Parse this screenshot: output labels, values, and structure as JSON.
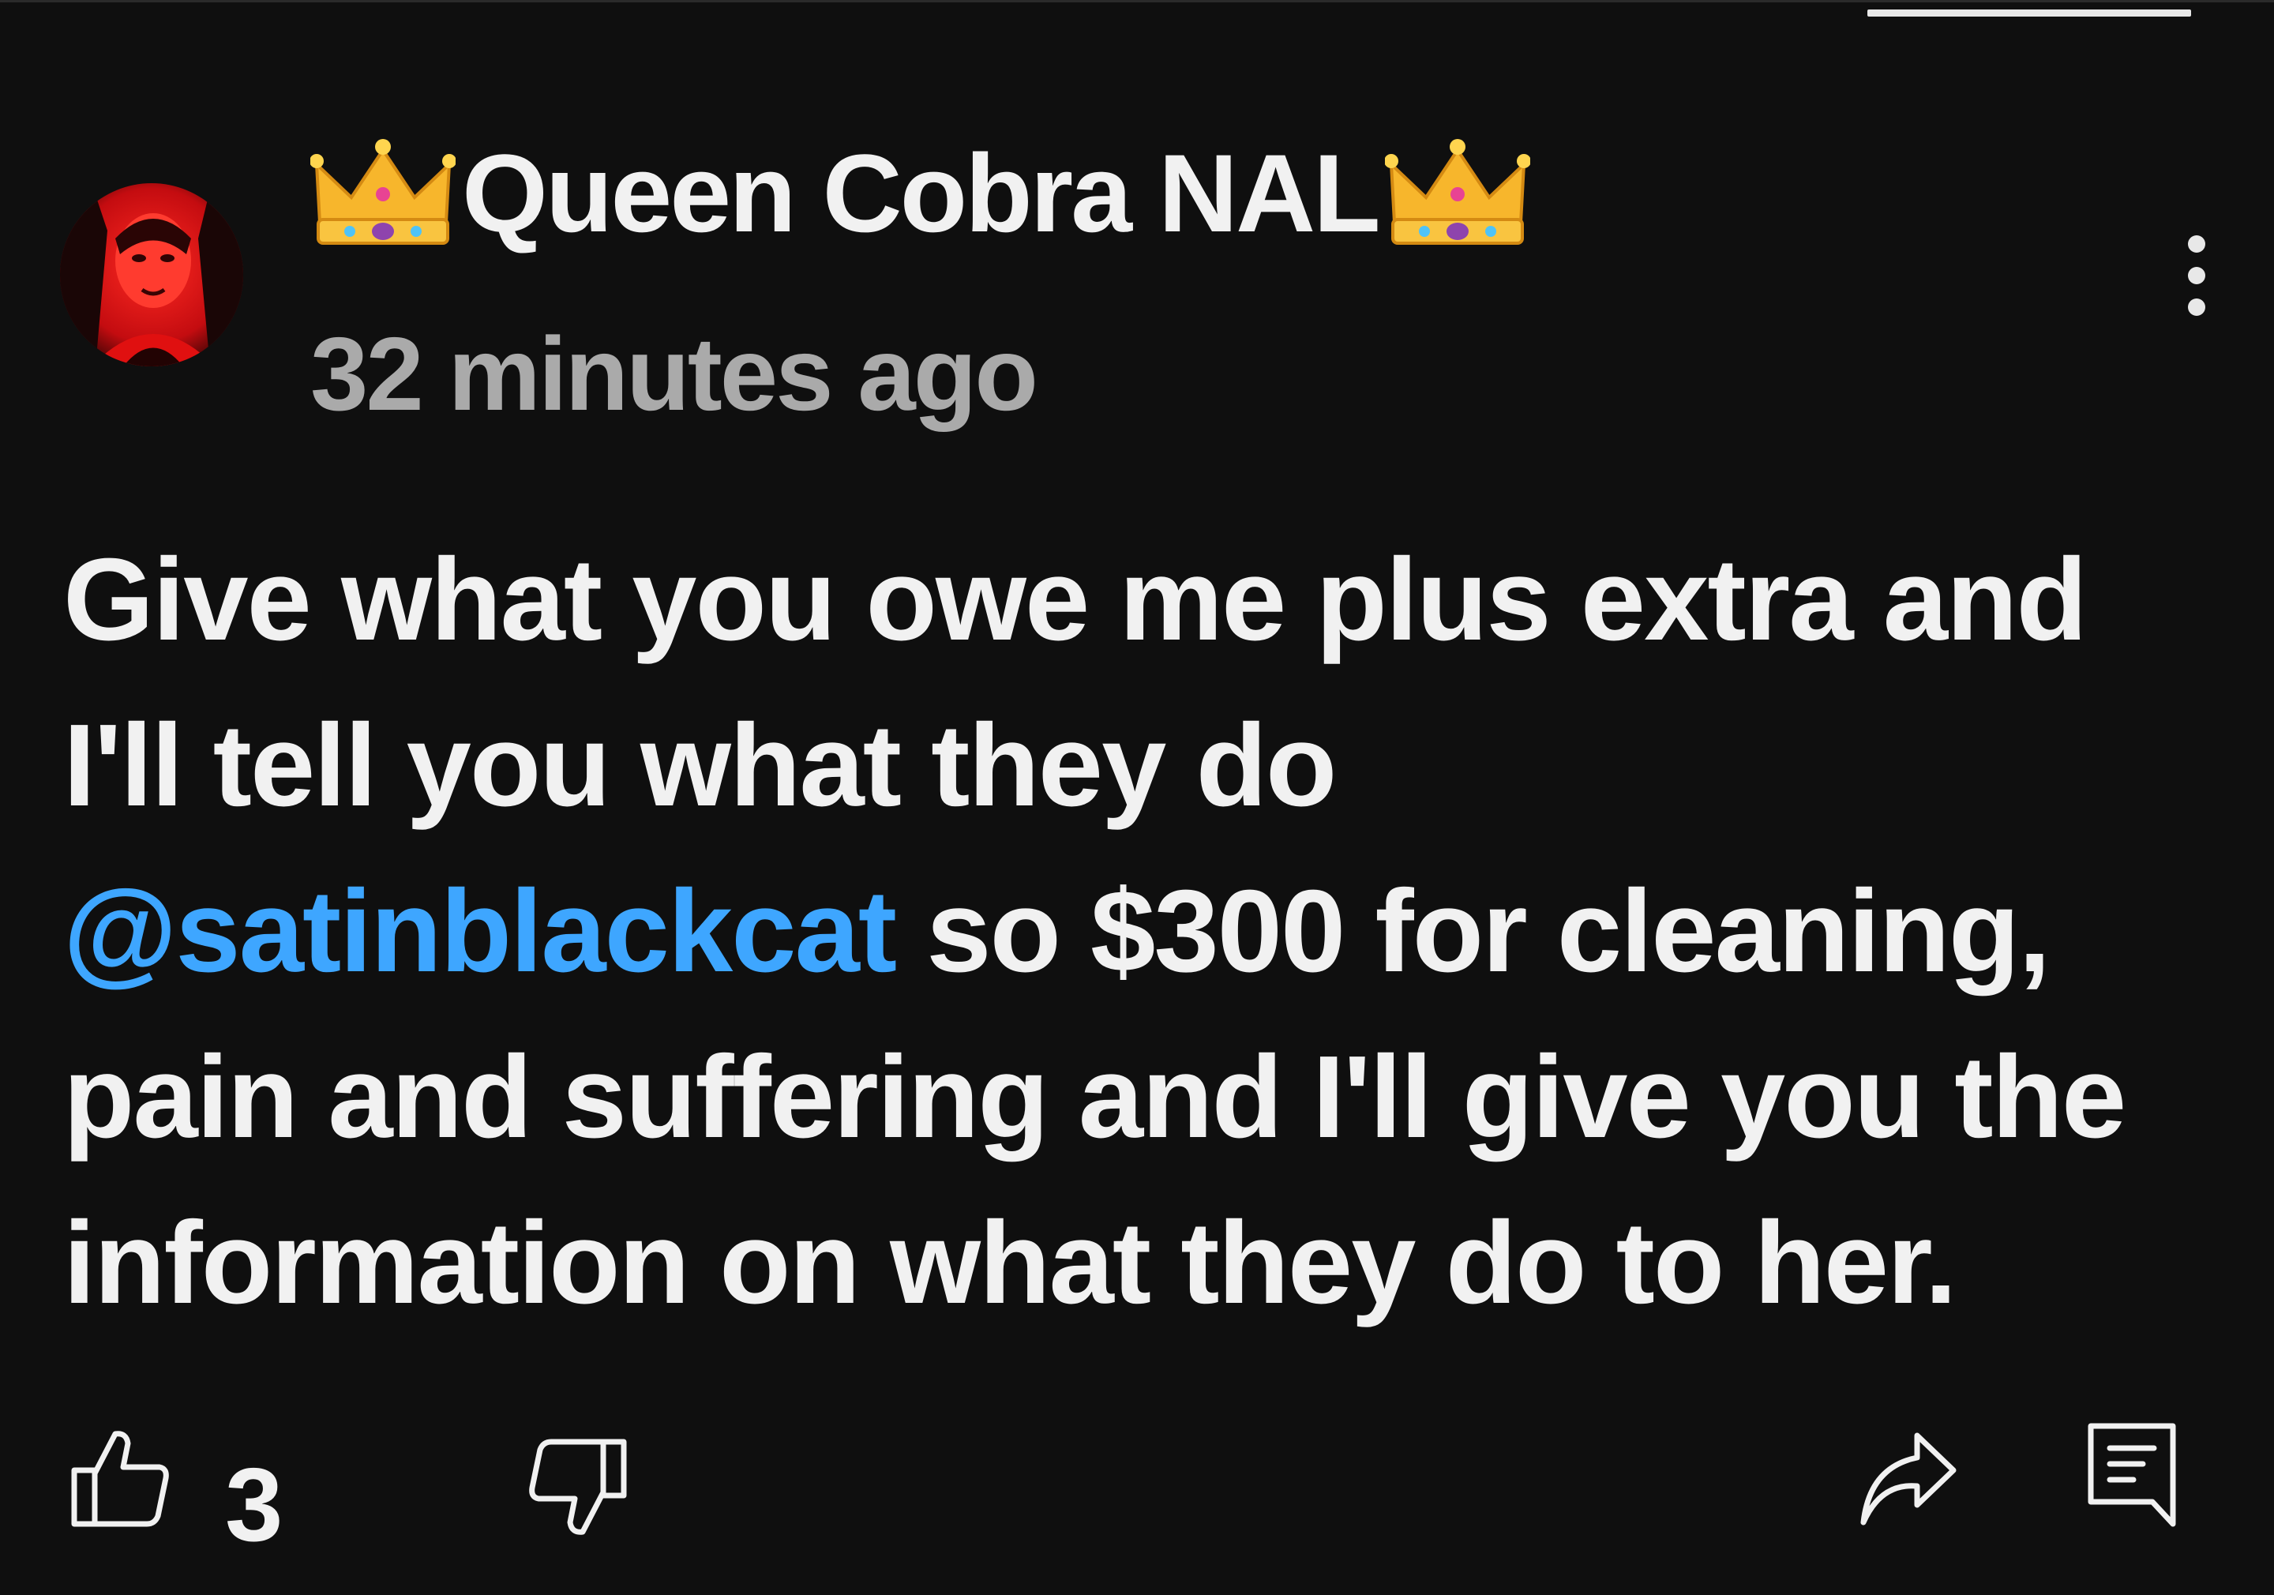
{
  "comment": {
    "author": {
      "prefix_emoji": "crown-emoji",
      "name": "Queen Cobra NAL",
      "suffix_emoji": "crown-emoji"
    },
    "timestamp": "32 minutes ago",
    "body_lines": [
      {
        "text": "Give what you owe me plus extra and"
      },
      {
        "text": "I'll tell you what they do"
      },
      {
        "mention": "@satinblackcat",
        "text": " so $300 for cleaning,"
      },
      {
        "text": "pain and suffering and I'll give you the"
      },
      {
        "text": "information on what they do to her."
      }
    ],
    "like_count": "3"
  },
  "icons": {
    "menu": "more-vert-icon",
    "like": "thumb-up-icon",
    "dislike": "thumb-down-icon",
    "share": "share-arrow-icon",
    "reply": "reply-comment-icon"
  },
  "colors": {
    "background": "#0f0f0f",
    "text": "#f1f1f1",
    "secondary_text": "#aaaaaa",
    "mention": "#3ea6ff",
    "avatar_accent": "#e4101a"
  }
}
